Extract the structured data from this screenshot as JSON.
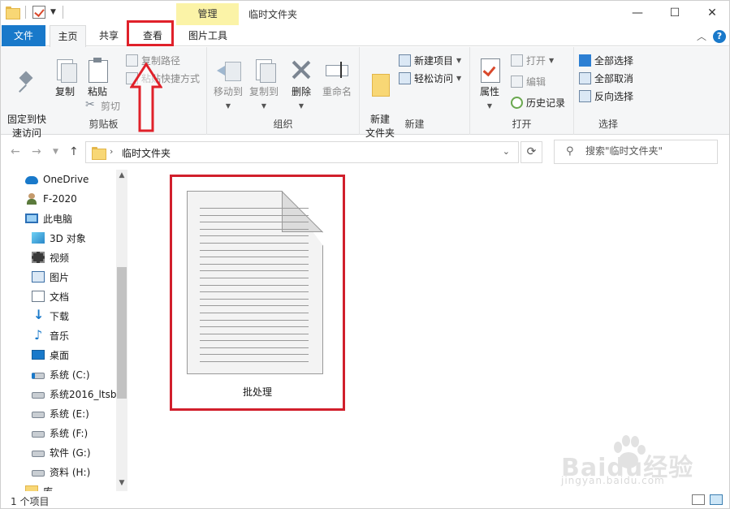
{
  "window": {
    "title": "临时文件夹",
    "contextual_tab_group": "管理",
    "controls": {
      "minimize": "—",
      "maximize": "☐",
      "close": "✕"
    }
  },
  "ribbon_tabs": [
    {
      "label": "文件"
    },
    {
      "label": "主页"
    },
    {
      "label": "共享"
    },
    {
      "label": "查看"
    },
    {
      "label": "图片工具"
    }
  ],
  "ribbon": {
    "clipboard": {
      "label": "剪贴板",
      "pin": "固定到快\n速访问",
      "copy": "复制",
      "paste": "粘贴",
      "copy_path": "复制路径",
      "paste_shortcut": "粘贴快捷方式",
      "cut": "剪切"
    },
    "organize": {
      "label": "组织",
      "move_to": "移动到",
      "copy_to": "复制到",
      "delete": "删除",
      "rename": "重命名"
    },
    "new": {
      "label": "新建",
      "new_folder": "新建\n文件夹",
      "new_item": "新建项目",
      "easy_access": "轻松访问"
    },
    "open": {
      "label": "打开",
      "properties": "属性",
      "open": "打开",
      "edit": "编辑",
      "history": "历史记录"
    },
    "select": {
      "label": "选择",
      "select_all": "全部选择",
      "select_none": "全部取消",
      "invert": "反向选择"
    },
    "help": "?"
  },
  "address": {
    "crumb": "临时文件夹",
    "search_placeholder": "搜索\"临时文件夹\""
  },
  "nav_pane": [
    {
      "label": "OneDrive",
      "icon": "onedrive-icon"
    },
    {
      "label": "F-2020",
      "icon": "user-icon"
    },
    {
      "label": "此电脑",
      "icon": "this-pc-icon"
    },
    {
      "label": "3D 对象",
      "icon": "3d-objects-icon"
    },
    {
      "label": "视频",
      "icon": "video-icon"
    },
    {
      "label": "图片",
      "icon": "pictures-icon"
    },
    {
      "label": "文档",
      "icon": "documents-icon"
    },
    {
      "label": "下载",
      "icon": "download-icon"
    },
    {
      "label": "音乐",
      "icon": "music-icon"
    },
    {
      "label": "桌面",
      "icon": "desktop-icon"
    },
    {
      "label": "系统 (C:)",
      "icon": "system-drive-icon"
    },
    {
      "label": "系统2016_ltsb",
      "icon": "drive-icon"
    },
    {
      "label": "系统 (E:)",
      "icon": "drive-icon"
    },
    {
      "label": "系统 (F:)",
      "icon": "drive-icon"
    },
    {
      "label": "软件 (G:)",
      "icon": "drive-icon"
    },
    {
      "label": "资料 (H:)",
      "icon": "drive-icon"
    },
    {
      "label": "库",
      "icon": "library-icon"
    }
  ],
  "files": [
    {
      "name": "批处理"
    }
  ],
  "status": {
    "item_count": "1 个项目"
  },
  "watermark": {
    "logo_text": "Baidu经验",
    "url": "jingyan.baidu.com"
  },
  "colors": {
    "accent": "#1979ca",
    "contextual_tab": "#fbf3a7",
    "annotation_red": "#e0212a"
  }
}
